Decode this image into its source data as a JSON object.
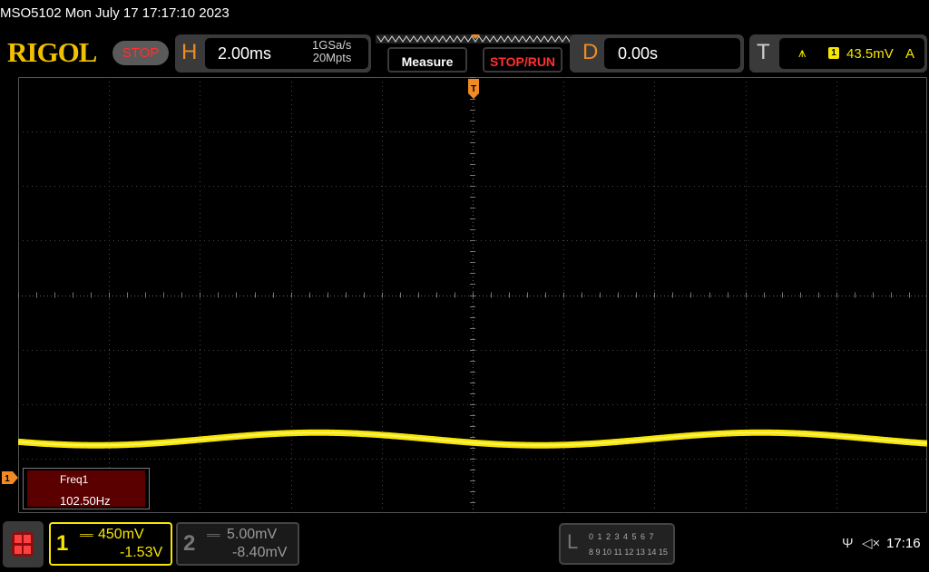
{
  "header": {
    "model_datetime": "MSO5102  Mon July 17 17:17:10 2023",
    "logo": "RIGOL",
    "run_state": "STOP"
  },
  "horizontal": {
    "letter": "H",
    "timebase": "2.00ms",
    "sample_rate": "1GSa/s",
    "memory_depth": "20Mpts"
  },
  "toolbar": {
    "measure_label": "Measure",
    "stop_run_label": "STOP/RUN"
  },
  "delay": {
    "letter": "D",
    "value": "0.00s"
  },
  "trigger": {
    "letter": "T",
    "source": "1",
    "level": "43.5mV",
    "mode": "A"
  },
  "measurement": {
    "label": "Freq1",
    "value": "102.50Hz"
  },
  "channel1": {
    "number": "1",
    "coupling_icon": "dc-coupling-icon",
    "scale": "450mV",
    "offset": "-1.53V",
    "color": "#f6e600"
  },
  "channel2": {
    "number": "2",
    "coupling_icon": "dc-coupling-icon",
    "scale": "5.00mV",
    "offset": "-8.40mV"
  },
  "logic": {
    "letter": "L",
    "row1": "0 1 2 3   4 5 6 7",
    "row2": "8 9 10 11 12 13 14 15"
  },
  "status": {
    "time": "17:16"
  },
  "waveform": {
    "frequency_hz": 102.5,
    "time_per_div_ms": 2.0,
    "volts_per_div": 0.45,
    "color": "#f6e600"
  },
  "colors": {
    "accent_orange": "#f08a24",
    "stop_red": "#ff3030",
    "channel1_yellow": "#f6e600"
  }
}
